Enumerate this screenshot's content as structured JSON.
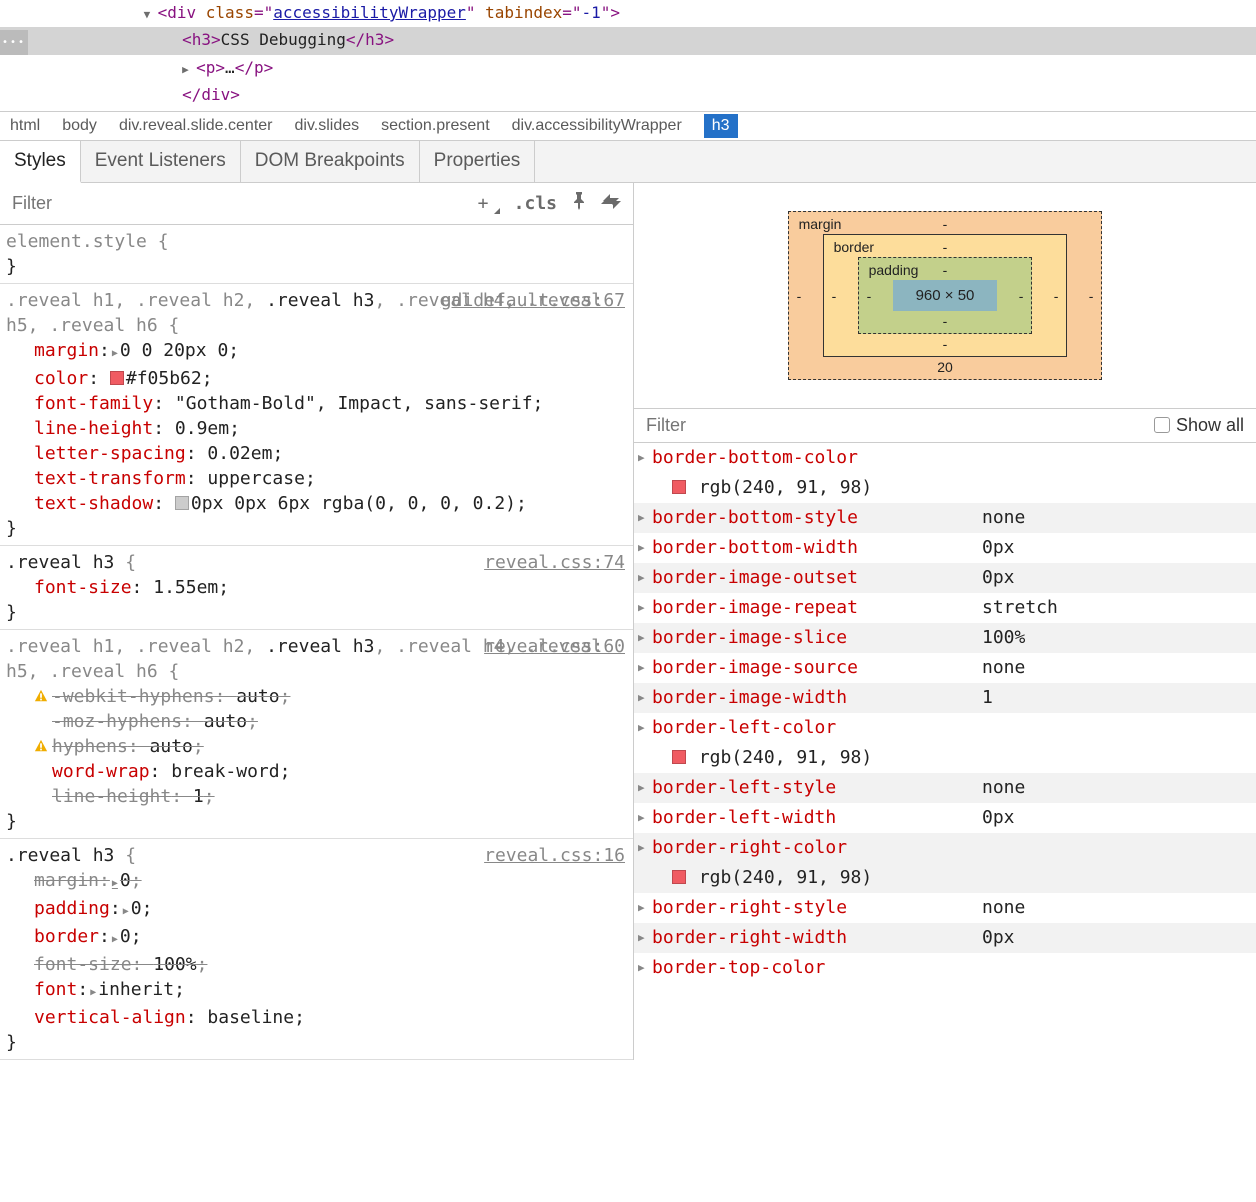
{
  "dom": {
    "line1_indent": "            ",
    "line1_tag": "div",
    "line1_attr_class": "class",
    "line1_class_val": "accessibilityWrapper",
    "line1_attr_tab": "tabindex",
    "line1_tab_val": "-1",
    "line2_indent": "                ",
    "line2_tag": "h3",
    "line2_text": "CSS Debugging",
    "line3_indent": "                ",
    "line3_tag": "p",
    "line3_ellipsis": "…",
    "line4_indent": "                ",
    "line4_close": "div"
  },
  "breadcrumb": [
    "html",
    "body",
    "div.reveal.slide.center",
    "div.slides",
    "section.present",
    "div.accessibilityWrapper",
    "h3"
  ],
  "tabs": [
    "Styles",
    "Event Listeners",
    "DOM Breakpoints",
    "Properties"
  ],
  "filter_placeholder": "Filter",
  "cls_label": ".cls",
  "rules": [
    {
      "selector_plain": "element.style ",
      "selector_bold": "",
      "source": "",
      "props": []
    },
    {
      "selector_html": ".reveal h1, .reveal h2, <b>.reveal h3</b>, .reveal h4, .reveal h5, .reveal h6 ",
      "source": "gdidefault.css:67",
      "props": [
        {
          "name": "margin",
          "tri": true,
          "val": "0 0 20px 0"
        },
        {
          "name": "color",
          "swatch": "#f05b62",
          "val": "#f05b62"
        },
        {
          "name": "font-family",
          "val": "\"Gotham-Bold\", Impact, sans-serif"
        },
        {
          "name": "line-height",
          "val": "0.9em"
        },
        {
          "name": "letter-spacing",
          "val": "0.02em"
        },
        {
          "name": "text-transform",
          "val": "uppercase"
        },
        {
          "name": "text-shadow",
          "swatch": "rgba(0,0,0,0.2)",
          "swatch_display": "#cccccc",
          "val": "0px 0px 6px ",
          "val2": "rgba(0, 0, 0, 0.2)"
        }
      ]
    },
    {
      "selector_html": "<b>.reveal h3</b> ",
      "source": "reveal.css:74",
      "props": [
        {
          "name": "font-size",
          "val": "1.55em"
        }
      ]
    },
    {
      "selector_html": ".reveal h1, .reveal h2, <b>.reveal h3</b>, .reveal h4, .reveal h5, .reveal h6 ",
      "source": "reveal.css:60",
      "props": [
        {
          "name": "-webkit-hyphens",
          "val": "auto",
          "strike": true,
          "warn": true
        },
        {
          "name": "-moz-hyphens",
          "val": "auto",
          "strike": true
        },
        {
          "name": "hyphens",
          "val": "auto",
          "strike": true,
          "warn": true
        },
        {
          "name": "word-wrap",
          "val": "break-word"
        },
        {
          "name": "line-height",
          "val": "1",
          "strike": true
        }
      ]
    },
    {
      "selector_html": "<b>.reveal h3</b> ",
      "source": "reveal.css:16",
      "props": [
        {
          "name": "margin",
          "tri": true,
          "val": "0",
          "strike": true
        },
        {
          "name": "padding",
          "tri": true,
          "val": "0"
        },
        {
          "name": "border",
          "tri": true,
          "val": "0"
        },
        {
          "name": "font-size",
          "val": "100%",
          "strike": true
        },
        {
          "name": "font",
          "tri": true,
          "val": "inherit"
        },
        {
          "name": "vertical-align",
          "val": "baseline"
        }
      ]
    }
  ],
  "boxmodel": {
    "margin_label": "margin",
    "border_label": "border",
    "padding_label": "padding",
    "content": "960 × 50",
    "margin": {
      "top": "-",
      "right": "-",
      "bottom": "20",
      "left": "-"
    },
    "border": {
      "top": "-",
      "right": "-",
      "bottom": "-",
      "left": "-"
    },
    "padding": {
      "top": "-",
      "right": "-",
      "bottom": "-",
      "left": "-"
    }
  },
  "computed_filter": "Filter",
  "show_all": "Show all",
  "computed": [
    {
      "name": "border-bottom-color",
      "swatch": "#f05b62",
      "val": "rgb(240, 91, 98)",
      "expandable": true
    },
    {
      "name": "border-bottom-style",
      "val": "none"
    },
    {
      "name": "border-bottom-width",
      "val": "0px"
    },
    {
      "name": "border-image-outset",
      "val": "0px"
    },
    {
      "name": "border-image-repeat",
      "val": "stretch"
    },
    {
      "name": "border-image-slice",
      "val": "100%"
    },
    {
      "name": "border-image-source",
      "val": "none"
    },
    {
      "name": "border-image-width",
      "val": "1"
    },
    {
      "name": "border-left-color",
      "swatch": "#f05b62",
      "val": "rgb(240, 91, 98)",
      "expandable": true
    },
    {
      "name": "border-left-style",
      "val": "none"
    },
    {
      "name": "border-left-width",
      "val": "0px"
    },
    {
      "name": "border-right-color",
      "swatch": "#f05b62",
      "val": "rgb(240, 91, 98)",
      "expandable": true
    },
    {
      "name": "border-right-style",
      "val": "none"
    },
    {
      "name": "border-right-width",
      "val": "0px"
    },
    {
      "name": "border-top-color",
      "val": "",
      "partial": true
    }
  ]
}
